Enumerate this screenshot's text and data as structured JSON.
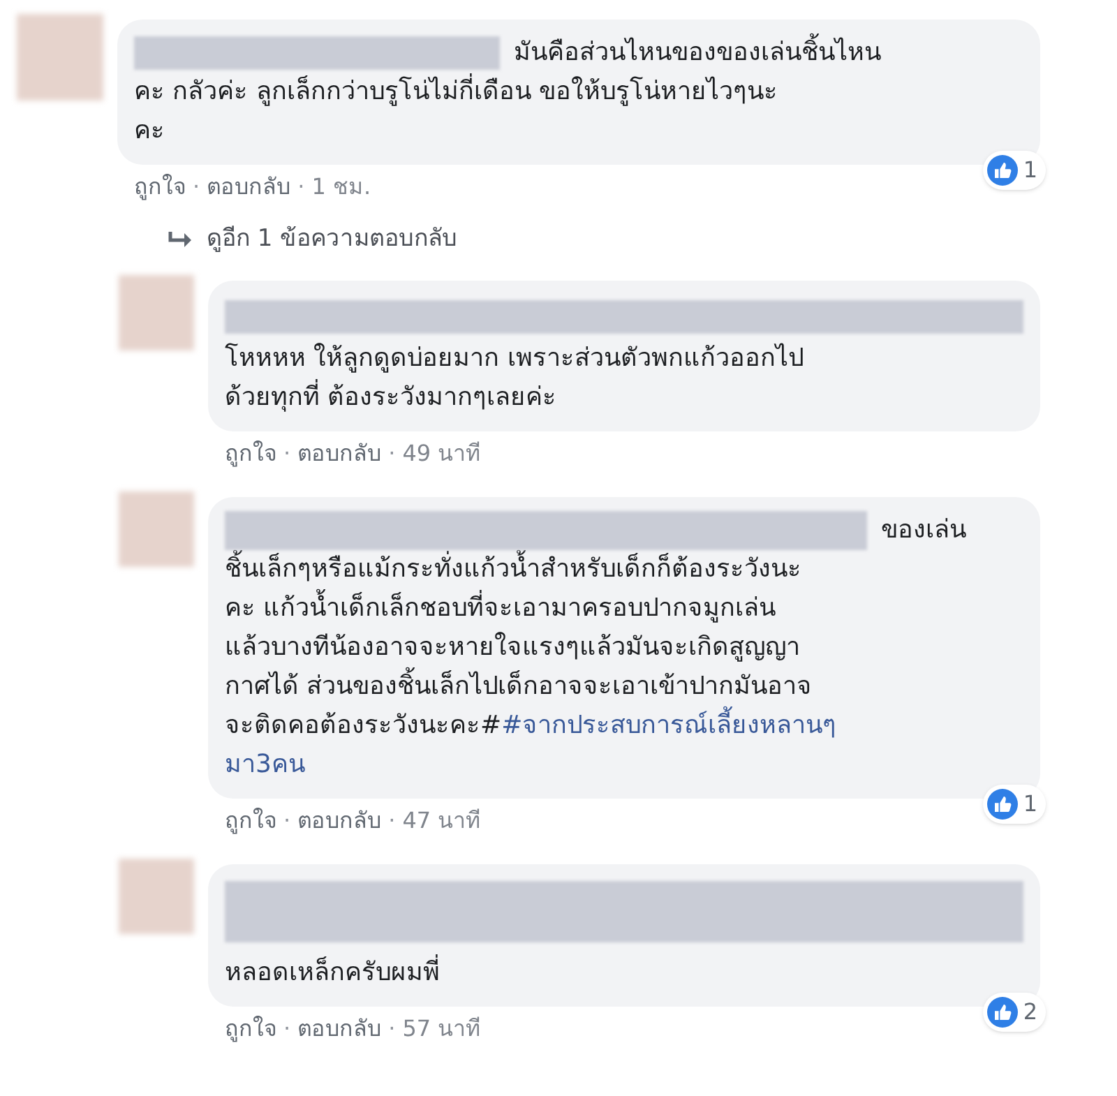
{
  "comments": [
    {
      "text": [
        {
          "kind": "lead",
          "text": "มันคือส่วนไหนของของเล่นชิ้นไหน"
        },
        {
          "kind": "text",
          "text": "คะ กลัวค่ะ ลูกเล็กกว่าบรูโน่ไม่กี่เดือน ขอให้บรูโน่หายไวๆนะ\nคะ"
        }
      ],
      "reactions": "1",
      "meta": [
        {
          "kind": "link",
          "text": "ถูกใจ"
        },
        {
          "kind": "sep",
          "text": "·"
        },
        {
          "kind": "link",
          "text": "ตอบกลับ"
        },
        {
          "kind": "sep",
          "text": "·"
        },
        {
          "kind": "time",
          "text": "1 ชม."
        }
      ],
      "more_replies": "ดูอีก 1 ข้อความตอบกลับ",
      "replies": [
        {
          "text": [
            {
              "kind": "text",
              "text": "โหหหห ให้ลูกดูดบ่อยมาก เพราะส่วนตัวพกแก้วออกไป\nด้วยทุกที่ ต้องระวังมากๆเลยค่ะ"
            }
          ],
          "meta": [
            {
              "kind": "link",
              "text": "ถูกใจ"
            },
            {
              "kind": "sep",
              "text": "·"
            },
            {
              "kind": "link",
              "text": "ตอบกลับ"
            },
            {
              "kind": "sep",
              "text": "·"
            },
            {
              "kind": "time",
              "text": "49 นาที"
            }
          ]
        },
        {
          "text": [
            {
              "kind": "lead",
              "text": "ของเล่น"
            },
            {
              "kind": "text",
              "text": "ชิ้นเล็กๆหรือแม้กระทั่งแก้วน้ำสำหรับเด็กก็ต้องระวังนะ\nคะ แก้วน้ำเด็กเล็กชอบที่จะเอามาครอบปากจมูกเล่น\nแล้วบางทีน้องอาจจะหายใจแรงๆแล้วมันจะเกิดสูญญา\nกาศได้ ส่วนของชิ้นเล็กไปเด็กอาจจะเอาเข้าปากมันอาจ\nจะติดคอต้องระวังนะคะ#"
            },
            {
              "kind": "hashtag",
              "text": "#จากประสบการณ์เลี้ยงหลานๆ"
            },
            {
              "kind": "hashtag",
              "text": "มา3คน"
            }
          ],
          "reactions": "1",
          "meta": [
            {
              "kind": "link",
              "text": "ถูกใจ"
            },
            {
              "kind": "sep",
              "text": "·"
            },
            {
              "kind": "link",
              "text": "ตอบกลับ"
            },
            {
              "kind": "sep",
              "text": "·"
            },
            {
              "kind": "time",
              "text": "47 นาที"
            }
          ]
        },
        {
          "text": [
            {
              "kind": "text",
              "text": "หลอดเหล็กครับผมพี่"
            }
          ],
          "reactions": "2",
          "meta": [
            {
              "kind": "link",
              "text": "ถูกใจ"
            },
            {
              "kind": "sep",
              "text": "·"
            },
            {
              "kind": "link",
              "text": "ตอบกลับ"
            },
            {
              "kind": "sep",
              "text": "·"
            },
            {
              "kind": "time",
              "text": "57 นาที"
            }
          ]
        }
      ]
    }
  ]
}
